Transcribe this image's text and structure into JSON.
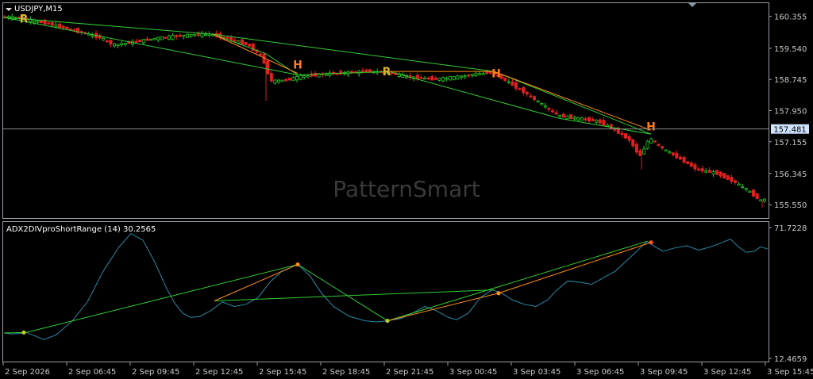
{
  "window": {
    "symbol_title": "USDJPY,M15",
    "watermark": "PatternSmart"
  },
  "colors": {
    "background": "#000000",
    "frame": "#9aa0a6",
    "bull": "#22cc22",
    "bear": "#e02020",
    "pattern_green": "#33cc33",
    "pattern_orange": "#ff8c1a",
    "label_r": "#e0b030",
    "label_h": "#ff7a1a",
    "indicator_line": "#2a8aa8",
    "current_price_bg": "#cfe3ff",
    "axis_text": "#c8c8c8",
    "watermark": "#3a3a3a"
  },
  "chart_data": [
    {
      "type": "candlestick",
      "title": "USDJPY,M15",
      "y_ticks": [
        "160.355",
        "159.540",
        "158.745",
        "157.950",
        "157.155",
        "156.345",
        "155.550"
      ],
      "y_tick_values": [
        160.355,
        159.54,
        158.745,
        157.95,
        157.155,
        156.345,
        155.55
      ],
      "ylim": [
        155.35,
        160.55
      ],
      "current_price": "157.481",
      "current_price_value": 157.481,
      "x_ticks": [
        "2 Sep 2026",
        "2 Sep 06:45",
        "2 Sep 09:45",
        "2 Sep 12:45",
        "2 Sep 15:45",
        "2 Sep 18:45",
        "2 Sep 21:45",
        "3 Sep 00:45",
        "3 Sep 03:45",
        "3 Sep 06:45",
        "3 Sep 09:45",
        "3 Sep 12:45",
        "3 Sep 15:45"
      ],
      "price_path": [
        [
          0,
          160.35
        ],
        [
          25,
          160.32
        ],
        [
          60,
          160.18
        ],
        [
          95,
          160.0
        ],
        [
          130,
          159.8
        ],
        [
          145,
          159.62
        ],
        [
          170,
          159.7
        ],
        [
          200,
          159.8
        ],
        [
          240,
          159.88
        ],
        [
          268,
          159.9
        ],
        [
          290,
          159.78
        ],
        [
          315,
          159.62
        ],
        [
          333,
          159.3
        ],
        [
          343,
          158.7
        ],
        [
          360,
          158.72
        ],
        [
          380,
          158.82
        ],
        [
          410,
          158.88
        ],
        [
          440,
          158.92
        ],
        [
          465,
          158.95
        ],
        [
          490,
          158.92
        ],
        [
          520,
          158.8
        ],
        [
          550,
          158.75
        ],
        [
          575,
          158.8
        ],
        [
          600,
          158.88
        ],
        [
          622,
          158.92
        ],
        [
          640,
          158.7
        ],
        [
          660,
          158.45
        ],
        [
          685,
          158.1
        ],
        [
          705,
          157.82
        ],
        [
          730,
          157.75
        ],
        [
          755,
          157.68
        ],
        [
          775,
          157.48
        ],
        [
          795,
          157.2
        ],
        [
          808,
          156.78
        ],
        [
          820,
          157.25
        ],
        [
          835,
          157.0
        ],
        [
          860,
          156.7
        ],
        [
          880,
          156.45
        ],
        [
          905,
          156.35
        ],
        [
          925,
          156.15
        ],
        [
          945,
          155.9
        ],
        [
          960,
          155.65
        ],
        [
          967,
          155.7
        ]
      ],
      "pattern_lines_green": [
        [
          [
            5,
            160.33
          ],
          [
            268,
            159.9
          ],
          [
            622,
            158.95
          ],
          [
            820,
            157.35
          ]
        ],
        [
          [
            5,
            160.33
          ],
          [
            375,
            158.86
          ],
          [
            490,
            158.95
          ]
        ],
        [
          [
            268,
            159.9
          ],
          [
            335,
            159.4
          ],
          [
            375,
            158.86
          ]
        ],
        [
          [
            490,
            158.95
          ],
          [
            705,
            157.75
          ],
          [
            820,
            157.35
          ]
        ]
      ],
      "pattern_lines_orange": [
        [
          [
            268,
            159.9
          ],
          [
            375,
            158.9
          ]
        ],
        [
          [
            490,
            158.95
          ],
          [
            622,
            158.95
          ],
          [
            820,
            157.45
          ]
        ]
      ],
      "pattern_labels": [
        {
          "text": "R",
          "x": 30,
          "y": 160.3
        },
        {
          "text": "H",
          "x": 375,
          "y": 159.12
        },
        {
          "text": "R",
          "x": 487,
          "y": 158.95
        },
        {
          "text": "H",
          "x": 625,
          "y": 158.9
        },
        {
          "text": "H",
          "x": 820,
          "y": 157.55
        }
      ]
    },
    {
      "type": "line",
      "title": "ADX2DIVproShortRange (14) 30.2565",
      "y_ticks": [
        "71.7228",
        "12.4659"
      ],
      "y_tick_values": [
        71.7228,
        12.4659
      ],
      "ylim": [
        12.4659,
        71.7228
      ],
      "series": [
        {
          "values": [
            [
              5,
              24.0
            ],
            [
              15,
              23.5
            ],
            [
              25,
              23.8
            ],
            [
              33,
              24.2
            ],
            [
              45,
              22.5
            ],
            [
              55,
              21.0
            ],
            [
              70,
              23.0
            ],
            [
              90,
              29.0
            ],
            [
              110,
              38.0
            ],
            [
              130,
              52.0
            ],
            [
              150,
              63.0
            ],
            [
              165,
              69.0
            ],
            [
              180,
              66.0
            ],
            [
              195,
              56.0
            ],
            [
              210,
              44.0
            ],
            [
              220,
              37.5
            ],
            [
              230,
              33.0
            ],
            [
              240,
              31.0
            ],
            [
              252,
              31.5
            ],
            [
              265,
              34.0
            ],
            [
              280,
              38.0
            ],
            [
              295,
              36.0
            ],
            [
              310,
              37.0
            ],
            [
              325,
              40.0
            ],
            [
              340,
              47.0
            ],
            [
              355,
              52.0
            ],
            [
              375,
              55.0
            ],
            [
              390,
              50.0
            ],
            [
              405,
              42.0
            ],
            [
              420,
              36.0
            ],
            [
              440,
              31.5
            ],
            [
              460,
              29.5
            ],
            [
              475,
              29.0
            ],
            [
              488,
              29.5
            ],
            [
              505,
              30.5
            ],
            [
              520,
              33.0
            ],
            [
              535,
              36.0
            ],
            [
              550,
              34.0
            ],
            [
              565,
              31.0
            ],
            [
              575,
              30.0
            ],
            [
              590,
              33.0
            ],
            [
              605,
              40.0
            ],
            [
              620,
              43.5
            ],
            [
              632,
              42.0
            ],
            [
              645,
              39.0
            ],
            [
              660,
              37.0
            ],
            [
              675,
              36.0
            ],
            [
              690,
              39.0
            ],
            [
              700,
              43.0
            ],
            [
              715,
              47.5
            ],
            [
              730,
              47.0
            ],
            [
              745,
              46.0
            ],
            [
              760,
              49.0
            ],
            [
              775,
              52.0
            ],
            [
              790,
              57.0
            ],
            [
              805,
              62.0
            ],
            [
              815,
              65.5
            ],
            [
              825,
              63.0
            ],
            [
              835,
              61.0
            ],
            [
              850,
              62.5
            ],
            [
              865,
              63.5
            ],
            [
              880,
              61.5
            ],
            [
              895,
              63.0
            ],
            [
              910,
              65.0
            ],
            [
              920,
              66.5
            ],
            [
              930,
              63.0
            ],
            [
              940,
              60.5
            ],
            [
              950,
              61.0
            ],
            [
              958,
              63.0
            ],
            [
              967,
              62.0
            ]
          ]
        }
      ],
      "pattern_lines_green": [
        [
          [
            5,
            24.0
          ],
          [
            33,
            24.2
          ],
          [
            375,
            55.0
          ]
        ],
        [
          [
            270,
            38.5
          ],
          [
            622,
            43.5
          ]
        ],
        [
          [
            375,
            55.0
          ],
          [
            488,
            29.5
          ]
        ],
        [
          [
            488,
            29.5
          ],
          [
            815,
            65.5
          ]
        ]
      ],
      "pattern_lines_orange": [
        [
          [
            270,
            38.5
          ],
          [
            375,
            55.0
          ]
        ],
        [
          [
            488,
            29.5
          ],
          [
            628,
            42.0
          ],
          [
            820,
            65.0
          ]
        ]
      ],
      "pattern_points": [
        {
          "x": 30,
          "y": 24.2,
          "color": "#bfd020"
        },
        {
          "x": 375,
          "y": 55.0,
          "color": "#ff8c1a"
        },
        {
          "x": 488,
          "y": 29.5,
          "color": "#bfd020"
        },
        {
          "x": 628,
          "y": 42.0,
          "color": "#ff8c1a"
        },
        {
          "x": 820,
          "y": 65.0,
          "color": "#ff5a1a"
        }
      ]
    }
  ]
}
